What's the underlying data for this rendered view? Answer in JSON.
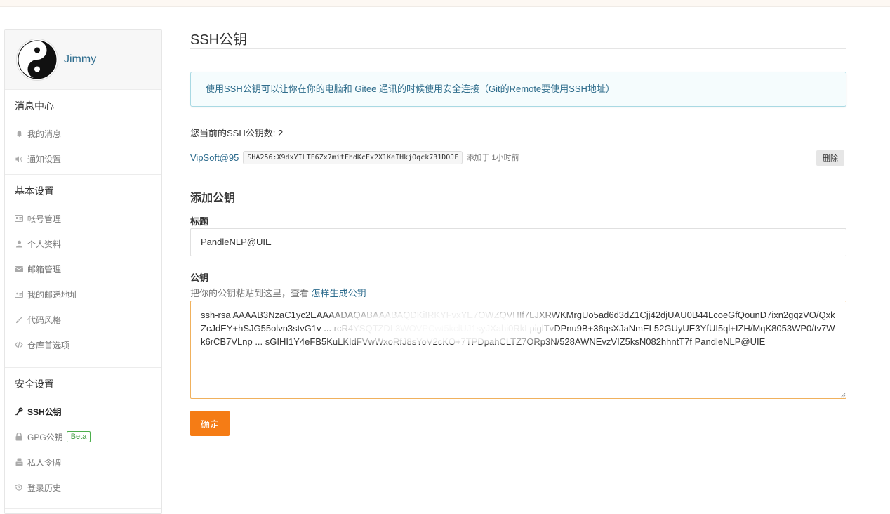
{
  "user": {
    "name": "Jimmy"
  },
  "sidebar": {
    "groups": [
      {
        "title": "消息中心",
        "items": [
          {
            "label": "我的消息",
            "icon": "bell-icon"
          },
          {
            "label": "通知设置",
            "icon": "speaker-icon"
          }
        ]
      },
      {
        "title": "基本设置",
        "items": [
          {
            "label": "帐号管理",
            "icon": "id-card-icon"
          },
          {
            "label": "个人资料",
            "icon": "user-icon"
          },
          {
            "label": "邮箱管理",
            "icon": "envelope-icon"
          },
          {
            "label": "我的邮递地址",
            "icon": "address-card-icon"
          },
          {
            "label": "代码风格",
            "icon": "brush-icon"
          },
          {
            "label": "仓库首选项",
            "icon": "code-icon"
          }
        ]
      },
      {
        "title": "安全设置",
        "items": [
          {
            "label": "SSH公钥",
            "icon": "key-icon",
            "active": true
          },
          {
            "label": "GPG公钥",
            "icon": "lock-icon",
            "badge": "Beta"
          },
          {
            "label": "私人令牌",
            "icon": "token-icon"
          },
          {
            "label": "登录历史",
            "icon": "history-icon"
          }
        ]
      }
    ]
  },
  "main": {
    "page_title": "SSH公钥",
    "info": "使用SSH公钥可以让你在你的电脑和 Gitee 通讯的时候使用安全连接（Git的Remote要使用SSH地址）",
    "key_count_text": "您当前的SSH公钥数: 2",
    "existing_key": {
      "name": "VipSoft@95",
      "fingerprint": "SHA256:X9dxYILTF6Zx7mitFhdKcFx2X1KeIHkjOqck731DOJE",
      "added": "添加于 1小时前",
      "delete_label": "删除"
    },
    "add_section_title": "添加公钥",
    "title_label": "标题",
    "title_value": "PandleNLP@UIE",
    "key_label": "公钥",
    "key_help": "把你的公钥粘贴到这里，查看 ",
    "key_help_link": "怎样生成公钥",
    "key_value": "ssh-rsa AAAAB3NzaC1yc2EAAAADAQABAAABAQDKiIRKYFvxYE7OWZQVHIf7LJXRWKMrgUo5ad6d3dZ1Cjj42djUAU0B44LcoeGfQounD7ixn2gqzVO/QxkZcJdEY+hSJG55olvn3stvG1v ... rcR4YSQTZDL3WOVPCwt5kclUJ1syJXahi0RkLpiglTvDPnu9B+36qsXJaNmEL52GUyUE3YfUI5ql+IZH/MqK8053WP0/tv7Wk6rCB7VLnp ... sGIHI1Y4eFB5KuLKIdFVwWxoRfJ8sYoV2cKO+7TPDpahCLTZ7ORp3N/528AWNEvzVIZ5ksN082hhntT7f PandleNLP@UIE",
    "confirm_label": "确定"
  }
}
